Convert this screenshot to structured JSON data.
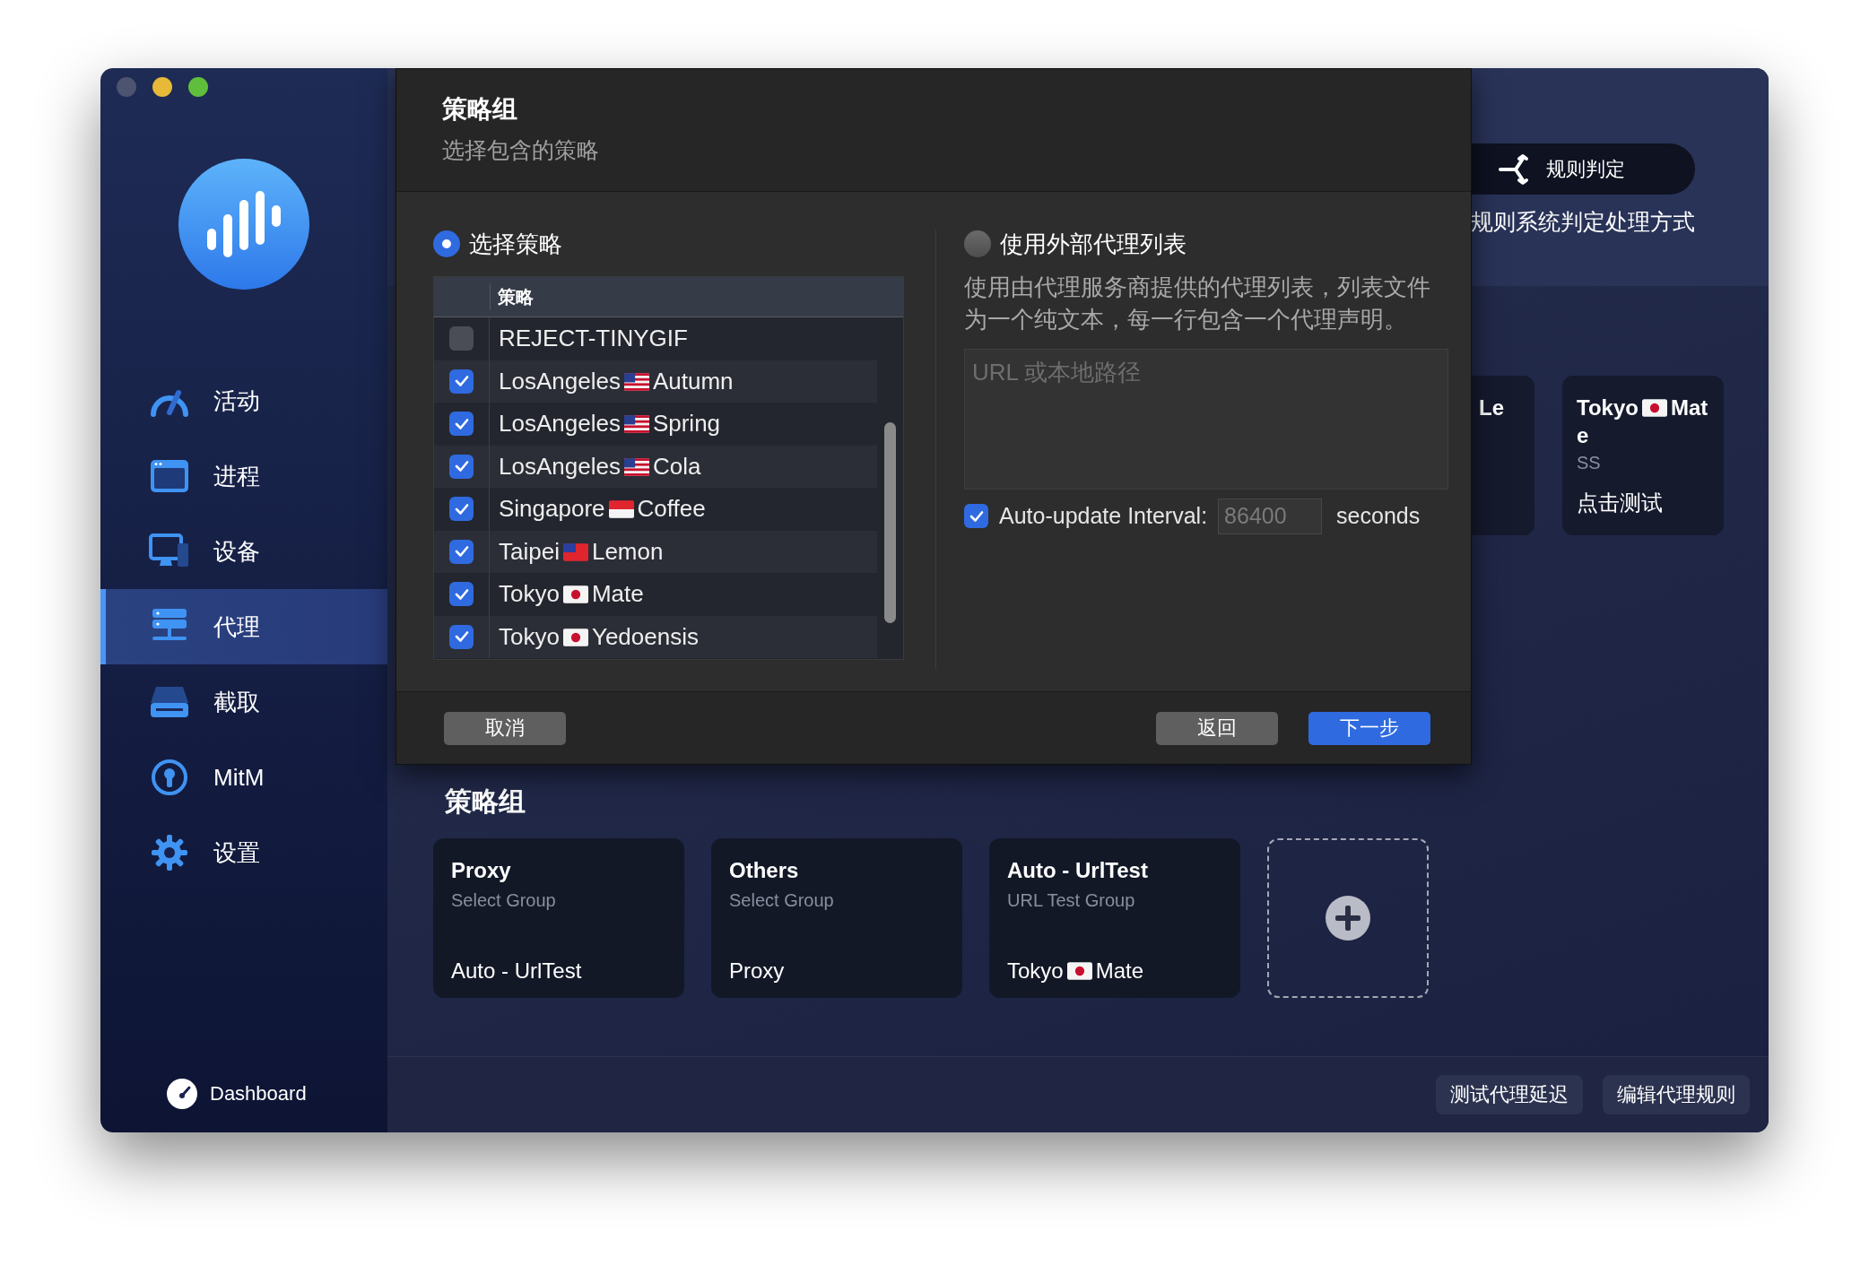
{
  "sidebar": {
    "items": [
      {
        "label": "活动",
        "kind": "activity",
        "selected": false
      },
      {
        "label": "进程",
        "kind": "process",
        "selected": false
      },
      {
        "label": "设备",
        "kind": "device",
        "selected": false
      },
      {
        "label": "代理",
        "kind": "proxy",
        "selected": true
      },
      {
        "label": "截取",
        "kind": "capture",
        "selected": false
      },
      {
        "label": "MitM",
        "kind": "mitm",
        "selected": false
      },
      {
        "label": "设置",
        "kind": "settings",
        "selected": false
      }
    ],
    "footer": "Dashboard"
  },
  "background": {
    "rule_button": "规则判定",
    "rule_description": "规则系统判定处理方式",
    "proxy_cards": [
      {
        "text": "Le"
      },
      {
        "text": "Tokyo",
        "kind": "jp",
        "text_after": "Mate",
        "protocol": "SS",
        "action": "点击测试"
      }
    ]
  },
  "policy_groups": {
    "title": "策略组",
    "cards": [
      {
        "name": "Proxy",
        "type": "Select Group",
        "text": "Auto - UrlTest"
      },
      {
        "name": "Others",
        "type": "Select Group",
        "text": "Proxy"
      },
      {
        "name": "Auto - UrlTest",
        "type": "URL Test Group",
        "text": "Tokyo",
        "kind": "jp",
        "text_after": "Mate"
      }
    ]
  },
  "bottom_bar": {
    "buttons": [
      "测试代理延迟",
      "编辑代理规则"
    ]
  },
  "dialog": {
    "title": "策略组",
    "subtitle": "选择包含的策略",
    "modes": [
      {
        "label": "选择策略",
        "selected": true
      },
      {
        "label": "使用外部代理列表",
        "selected": false
      }
    ],
    "policy_table": {
      "column": "策略",
      "rows": [
        {
          "text": "REJECT-TINYGIF",
          "checked": false
        },
        {
          "text": "LosAngeles",
          "kind": "us",
          "text_after": "Autumn",
          "checked": true
        },
        {
          "text": "LosAngeles",
          "kind": "us",
          "text_after": "Spring",
          "checked": true
        },
        {
          "text": "LosAngeles",
          "kind": "us",
          "text_after": "Cola",
          "checked": true
        },
        {
          "text": "Singapore",
          "kind": "sg",
          "text_after": "Coffee",
          "checked": true
        },
        {
          "text": "Taipei",
          "kind": "tw",
          "text_after": "Lemon",
          "checked": true
        },
        {
          "text": "Tokyo",
          "kind": "jp",
          "text_after": "Mate",
          "checked": true
        },
        {
          "text": "Tokyo",
          "kind": "jp",
          "text_after": "Yedoensis",
          "checked": true
        }
      ]
    },
    "external": {
      "description": "使用由代理服务商提供的代理列表，列表文件为一个纯文本，每一行包含一个代理声明。",
      "url_field": {
        "placeholder": "URL 或本地路径"
      },
      "auto_update": {
        "label": "Auto-update Interval:",
        "checked": true,
        "placeholder": "86400",
        "unit": "seconds"
      }
    },
    "buttons": [
      {
        "label": "取消",
        "kind": "secondary"
      },
      {
        "label": "返回",
        "kind": "secondary"
      },
      {
        "label": "下一步",
        "kind": "primary"
      }
    ]
  }
}
